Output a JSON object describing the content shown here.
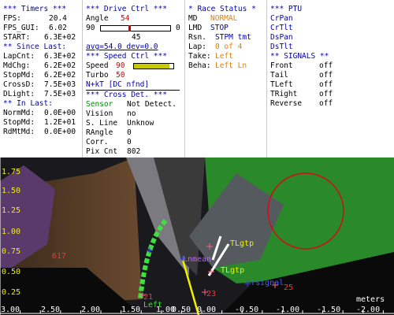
{
  "timers": {
    "header": "*** Timers ***",
    "fps_label": "FPS:",
    "fps": "20.4",
    "fps_gui_label": "FPS_GUI:",
    "fps_gui": "6.02",
    "start_label": "START:",
    "start": "6.3E+02",
    "since_header": "** Since Last:",
    "since": [
      {
        "label": "LapCnt:",
        "value": "6.3E+02"
      },
      {
        "label": "MdChg:",
        "value": "6.2E+02"
      },
      {
        "label": "StopMd:",
        "value": "6.2E+02"
      },
      {
        "label": "CrossD:",
        "value": "7.5E+03"
      },
      {
        "label": "DLight:",
        "value": "7.5E+03"
      }
    ],
    "in_header": "** In Last:",
    "in_last": [
      {
        "label": "NormMd:",
        "value": "0.0E+00"
      },
      {
        "label": "StopMd:",
        "value": "1.2E+01"
      },
      {
        "label": "RdMtMd:",
        "value": "0.0E+00"
      }
    ]
  },
  "drive": {
    "header": "***  Drive Ctrl  ***",
    "angle_label": "Angle",
    "angle": "54",
    "min": "90",
    "max": "0",
    "mid": "45",
    "angle_level": 0.4,
    "avg_label": "avg=54.0  dev=0.0",
    "speed_header": "***  Speed Ctrl  ***",
    "speed_label": "Speed",
    "speed": "90",
    "speed_level": 0.9,
    "turbo_label": "Turbo",
    "turbo": "50",
    "nkt_label": "N+kT [DC nfnd]",
    "cross_header": "*** Cross Det. ***",
    "sensor_label": "Sensor",
    "sensor_value": "Not Detect.",
    "vision_label": "Vision",
    "vision_value": "no",
    "sline_label": "S. Line",
    "sline_value": "Unknow",
    "rangle_label": "RAngle",
    "rangle_value": "0",
    "corr_label": "Corr.",
    "corr_value": "0",
    "pix_label": "Pix Cnt",
    "pix_value": "802"
  },
  "race": {
    "header": "* Race Status *",
    "md_label": "MD",
    "md_value": "NORMAL",
    "lmd_label": "LMD",
    "lmd_value": "STOP",
    "rsn_label": "Rsn.",
    "rsn_value": "STPM tmt",
    "lap_label": "Lap:",
    "lap_value": "0 of 4",
    "take_label": "Take:",
    "take_value": "Left",
    "beha_label": "Beha:",
    "beha_value": "Left Ln"
  },
  "ptu": {
    "header": "*** PTU",
    "items": [
      "CrPan",
      "CrTlt",
      "DsPan",
      "DsTlt"
    ],
    "signals_header": "** SIGNALS **",
    "signals": [
      {
        "label": "Front",
        "value": "off"
      },
      {
        "label": "Tail",
        "value": "off"
      },
      {
        "label": "TLeft",
        "value": "off"
      },
      {
        "label": "TRight",
        "value": "off"
      },
      {
        "label": "Reverse",
        "value": "off"
      }
    ]
  },
  "view": {
    "y_ticks": [
      "1.75",
      "1.50",
      "1.25",
      "1.00",
      "0.75",
      "0.50",
      "0.25"
    ],
    "x_ticks": [
      "3.00",
      "2.50",
      "2.00",
      "1.50",
      "1.00",
      "0.50",
      "0.00",
      "-0.50",
      "-1.00",
      "-1.50",
      "-2.00"
    ],
    "units": "meters",
    "labels": {
      "l617": "617",
      "tlgtp1": "TLgtp",
      "lnmean": "Lnmean",
      "tlgtp2": "TLgtp",
      "l23": "23",
      "l25": "25",
      "tsignal": "Tsignal",
      "l21": "21",
      "left": "Left"
    }
  },
  "colors": {
    "blue": "#0000b0",
    "red": "#d00000",
    "orange": "#e08000",
    "green": "#009000",
    "field_green": "#2a8a2a",
    "target_red": "#d01010",
    "lane_yellow": "#f0f000"
  }
}
